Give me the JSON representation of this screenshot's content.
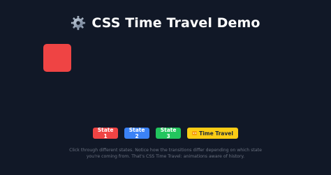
{
  "header": {
    "title": "CSS Time Travel Demo",
    "icon": "gear-icon"
  },
  "demo_box": {
    "color": "#ef4444"
  },
  "controls": {
    "buttons": [
      {
        "label": "State 1",
        "color": "#ef4444"
      },
      {
        "label": "State 2",
        "color": "#3b82f6"
      },
      {
        "label": "State 3",
        "color": "#22c55e"
      },
      {
        "label": "Time Travel",
        "color": "#facc15",
        "icon": "rewind-icon"
      }
    ]
  },
  "caption": {
    "line1": "Click through different states. Notice how the transitions differ depending on which state",
    "line2": "you're coming from. That's CSS Time Travel: animations aware of history."
  },
  "theme": {
    "background": "#111827",
    "title_color": "#ffffff",
    "caption_color": "#6b7280"
  }
}
